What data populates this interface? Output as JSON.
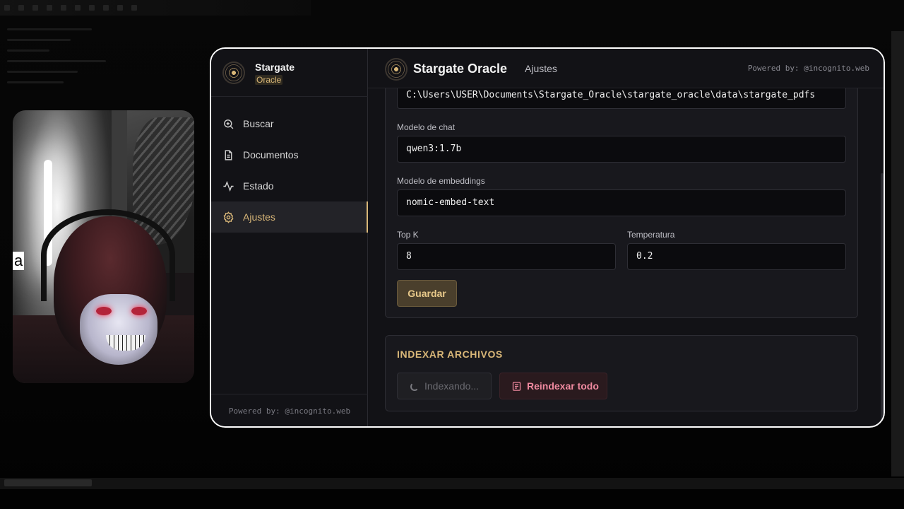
{
  "sidebar": {
    "brand_title": "Stargate",
    "brand_subtitle": "Oracle",
    "items": [
      {
        "label": "Buscar",
        "icon": "search-icon"
      },
      {
        "label": "Documentos",
        "icon": "document-icon"
      },
      {
        "label": "Estado",
        "icon": "activity-icon"
      },
      {
        "label": "Ajustes",
        "icon": "gear-icon",
        "active": true
      }
    ],
    "footer": "Powered by: @incognito.web"
  },
  "header": {
    "title": "Stargate Oracle",
    "tab": "Ajustes",
    "powered": "Powered by: @incognito.web"
  },
  "settings": {
    "path_value": "C:\\Users\\USER\\Documents\\Stargate_Oracle\\stargate_oracle\\data\\stargate_pdfs",
    "chat_model_label": "Modelo de chat",
    "chat_model_value": "qwen3:1.7b",
    "embeddings_label": "Modelo de embeddings",
    "embeddings_value": "nomic-embed-text",
    "topk_label": "Top K",
    "topk_value": "8",
    "temperature_label": "Temperatura",
    "temperature_value": "0.2",
    "save_label": "Guardar"
  },
  "indexing": {
    "title": "INDEXAR ARCHIVOS",
    "indexing_label": "Indexando...",
    "reindex_label": "Reindexar todo"
  },
  "webcam": {
    "caption": "a"
  },
  "colors": {
    "accent": "#d9b778",
    "danger": "#f08aa0",
    "background": "#121216"
  }
}
